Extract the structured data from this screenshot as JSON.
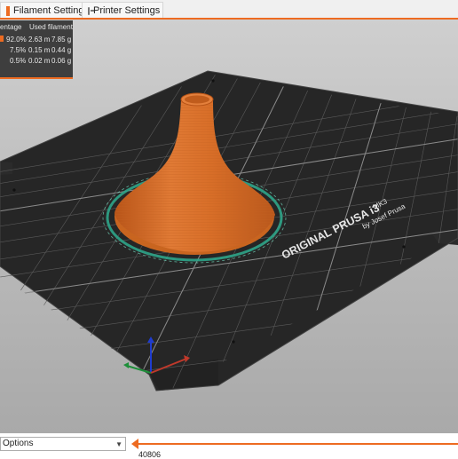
{
  "tabs": [
    {
      "label": "Filament Settings",
      "icon": "filament-spool-icon"
    },
    {
      "label": "Printer Settings",
      "icon": "printer-icon"
    }
  ],
  "legend": {
    "col_percentage": "entage",
    "col_used": "Used filament",
    "rows": [
      {
        "percent": "92.0%",
        "length": "2.63 m",
        "weight": "7.85 g"
      },
      {
        "percent": "7.5%",
        "length": "0.15 m",
        "weight": "0.44 g"
      },
      {
        "percent": "0.5%",
        "length": "0.02 m",
        "weight": "0.06 g"
      }
    ]
  },
  "bed": {
    "brand_line": "ORIGINAL PRUSA i3",
    "model": "MK3",
    "byline": "by Josef Prusa"
  },
  "bottom": {
    "options_label": "Options",
    "layer_value": "40806"
  },
  "colors": {
    "accent": "#ed6b21",
    "model": "#d9702a",
    "skirt": "#2fa58a",
    "bed": "#2b2b2b"
  }
}
